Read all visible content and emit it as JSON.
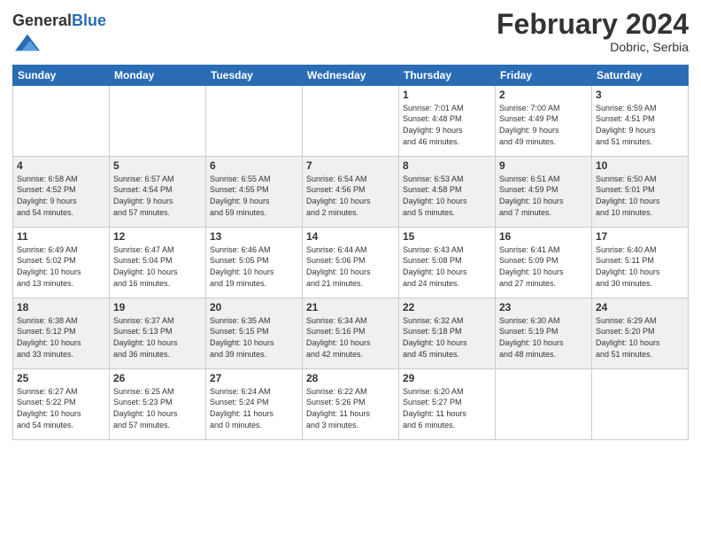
{
  "header": {
    "logo_general": "General",
    "logo_blue": "Blue",
    "month_title": "February 2024",
    "location": "Dobric, Serbia"
  },
  "weekdays": [
    "Sunday",
    "Monday",
    "Tuesday",
    "Wednesday",
    "Thursday",
    "Friday",
    "Saturday"
  ],
  "weeks": [
    {
      "shaded": false,
      "days": [
        {
          "num": "",
          "info": ""
        },
        {
          "num": "",
          "info": ""
        },
        {
          "num": "",
          "info": ""
        },
        {
          "num": "",
          "info": ""
        },
        {
          "num": "1",
          "info": "Sunrise: 7:01 AM\nSunset: 4:48 PM\nDaylight: 9 hours\nand 46 minutes."
        },
        {
          "num": "2",
          "info": "Sunrise: 7:00 AM\nSunset: 4:49 PM\nDaylight: 9 hours\nand 49 minutes."
        },
        {
          "num": "3",
          "info": "Sunrise: 6:59 AM\nSunset: 4:51 PM\nDaylight: 9 hours\nand 51 minutes."
        }
      ]
    },
    {
      "shaded": true,
      "days": [
        {
          "num": "4",
          "info": "Sunrise: 6:58 AM\nSunset: 4:52 PM\nDaylight: 9 hours\nand 54 minutes."
        },
        {
          "num": "5",
          "info": "Sunrise: 6:57 AM\nSunset: 4:54 PM\nDaylight: 9 hours\nand 57 minutes."
        },
        {
          "num": "6",
          "info": "Sunrise: 6:55 AM\nSunset: 4:55 PM\nDaylight: 9 hours\nand 59 minutes."
        },
        {
          "num": "7",
          "info": "Sunrise: 6:54 AM\nSunset: 4:56 PM\nDaylight: 10 hours\nand 2 minutes."
        },
        {
          "num": "8",
          "info": "Sunrise: 6:53 AM\nSunset: 4:58 PM\nDaylight: 10 hours\nand 5 minutes."
        },
        {
          "num": "9",
          "info": "Sunrise: 6:51 AM\nSunset: 4:59 PM\nDaylight: 10 hours\nand 7 minutes."
        },
        {
          "num": "10",
          "info": "Sunrise: 6:50 AM\nSunset: 5:01 PM\nDaylight: 10 hours\nand 10 minutes."
        }
      ]
    },
    {
      "shaded": false,
      "days": [
        {
          "num": "11",
          "info": "Sunrise: 6:49 AM\nSunset: 5:02 PM\nDaylight: 10 hours\nand 13 minutes."
        },
        {
          "num": "12",
          "info": "Sunrise: 6:47 AM\nSunset: 5:04 PM\nDaylight: 10 hours\nand 16 minutes."
        },
        {
          "num": "13",
          "info": "Sunrise: 6:46 AM\nSunset: 5:05 PM\nDaylight: 10 hours\nand 19 minutes."
        },
        {
          "num": "14",
          "info": "Sunrise: 6:44 AM\nSunset: 5:06 PM\nDaylight: 10 hours\nand 21 minutes."
        },
        {
          "num": "15",
          "info": "Sunrise: 6:43 AM\nSunset: 5:08 PM\nDaylight: 10 hours\nand 24 minutes."
        },
        {
          "num": "16",
          "info": "Sunrise: 6:41 AM\nSunset: 5:09 PM\nDaylight: 10 hours\nand 27 minutes."
        },
        {
          "num": "17",
          "info": "Sunrise: 6:40 AM\nSunset: 5:11 PM\nDaylight: 10 hours\nand 30 minutes."
        }
      ]
    },
    {
      "shaded": true,
      "days": [
        {
          "num": "18",
          "info": "Sunrise: 6:38 AM\nSunset: 5:12 PM\nDaylight: 10 hours\nand 33 minutes."
        },
        {
          "num": "19",
          "info": "Sunrise: 6:37 AM\nSunset: 5:13 PM\nDaylight: 10 hours\nand 36 minutes."
        },
        {
          "num": "20",
          "info": "Sunrise: 6:35 AM\nSunset: 5:15 PM\nDaylight: 10 hours\nand 39 minutes."
        },
        {
          "num": "21",
          "info": "Sunrise: 6:34 AM\nSunset: 5:16 PM\nDaylight: 10 hours\nand 42 minutes."
        },
        {
          "num": "22",
          "info": "Sunrise: 6:32 AM\nSunset: 5:18 PM\nDaylight: 10 hours\nand 45 minutes."
        },
        {
          "num": "23",
          "info": "Sunrise: 6:30 AM\nSunset: 5:19 PM\nDaylight: 10 hours\nand 48 minutes."
        },
        {
          "num": "24",
          "info": "Sunrise: 6:29 AM\nSunset: 5:20 PM\nDaylight: 10 hours\nand 51 minutes."
        }
      ]
    },
    {
      "shaded": false,
      "days": [
        {
          "num": "25",
          "info": "Sunrise: 6:27 AM\nSunset: 5:22 PM\nDaylight: 10 hours\nand 54 minutes."
        },
        {
          "num": "26",
          "info": "Sunrise: 6:25 AM\nSunset: 5:23 PM\nDaylight: 10 hours\nand 57 minutes."
        },
        {
          "num": "27",
          "info": "Sunrise: 6:24 AM\nSunset: 5:24 PM\nDaylight: 11 hours\nand 0 minutes."
        },
        {
          "num": "28",
          "info": "Sunrise: 6:22 AM\nSunset: 5:26 PM\nDaylight: 11 hours\nand 3 minutes."
        },
        {
          "num": "29",
          "info": "Sunrise: 6:20 AM\nSunset: 5:27 PM\nDaylight: 11 hours\nand 6 minutes."
        },
        {
          "num": "",
          "info": ""
        },
        {
          "num": "",
          "info": ""
        }
      ]
    }
  ]
}
